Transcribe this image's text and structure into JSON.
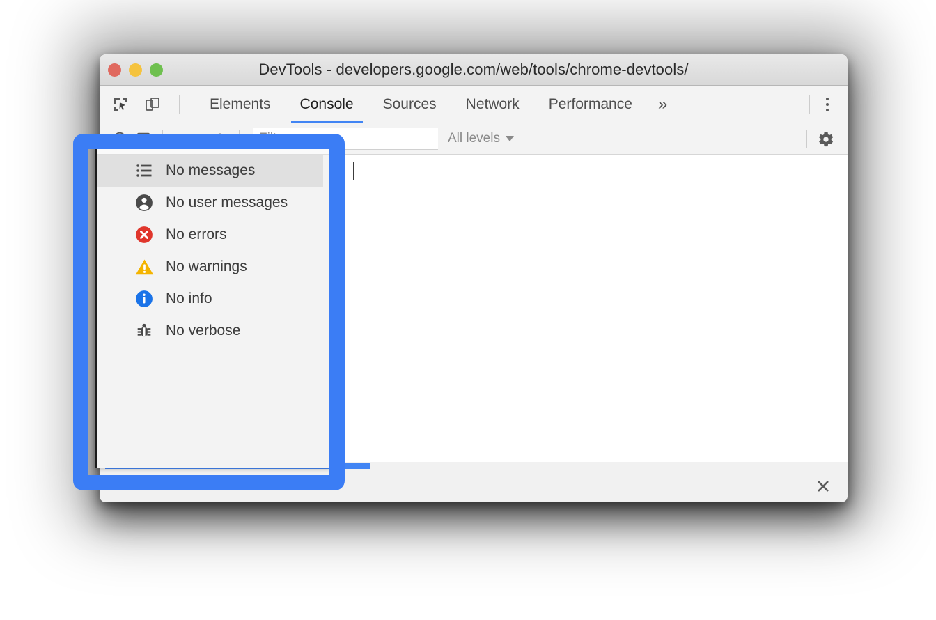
{
  "window": {
    "title": "DevTools - developers.google.com/web/tools/chrome-devtools/",
    "traffic_lights": [
      {
        "name": "close",
        "color": "#e0695f"
      },
      {
        "name": "minimize",
        "color": "#f5c33e"
      },
      {
        "name": "zoom",
        "color": "#6fc04f"
      }
    ]
  },
  "tabstrip": {
    "inspect_icon": "inspect-element-icon",
    "device_icon": "device-toolbar-icon",
    "tabs": [
      {
        "label": "Elements",
        "active": false
      },
      {
        "label": "Console",
        "active": true
      },
      {
        "label": "Sources",
        "active": false
      },
      {
        "label": "Network",
        "active": false
      },
      {
        "label": "Performance",
        "active": false
      }
    ],
    "more_tabs_label": "»",
    "menu_icon": "kebab-menu-icon",
    "active_tab_underline_color": "#4285f4"
  },
  "console_toolbar": {
    "context_caret_icon": "chevron-down-icon",
    "eye_icon": "eye-icon",
    "filter": {
      "placeholder": "Filter",
      "value": ""
    },
    "levels": {
      "label": "All levels",
      "caret_icon": "chevron-down-icon"
    },
    "settings_icon": "gear-icon"
  },
  "levels_dropdown": {
    "items": [
      {
        "label": "No messages",
        "icon": "list-icon",
        "highlighted": true
      },
      {
        "label": "No user messages",
        "icon": "person-icon",
        "highlighted": false
      },
      {
        "label": "No errors",
        "icon": "error-icon",
        "highlighted": false
      },
      {
        "label": "No warnings",
        "icon": "warning-icon",
        "highlighted": false
      },
      {
        "label": "No info",
        "icon": "info-icon",
        "highlighted": false
      },
      {
        "label": "No verbose",
        "icon": "bug-icon",
        "highlighted": false
      }
    ],
    "colors": {
      "error": "#e0362c",
      "warning": "#f4b400",
      "info": "#1a73e8",
      "neutral": "#4a4a4a"
    }
  },
  "console_bottom": {
    "close_icon": "close-icon"
  },
  "annotation": {
    "color": "#3b7df5"
  }
}
